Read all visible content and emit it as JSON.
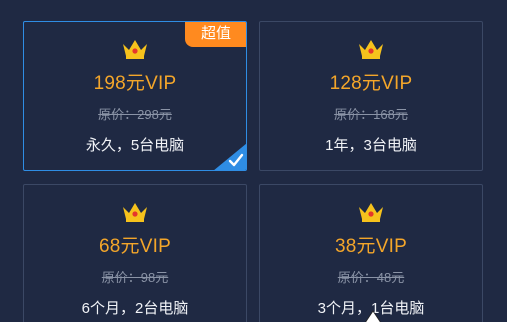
{
  "plans": [
    {
      "price_label": "198元VIP",
      "original_label": "原价：298元",
      "desc": "永久，5台电脑",
      "badge": "超值",
      "selected": true,
      "crown_icon": "crown-icon"
    },
    {
      "price_label": "128元VIP",
      "original_label": "原价：168元",
      "desc": "1年，3台电脑",
      "selected": false,
      "crown_icon": "crown-icon"
    },
    {
      "price_label": "68元VIP",
      "original_label": "原价：98元",
      "desc": "6个月，2台电脑",
      "selected": false,
      "crown_icon": "crown-icon"
    },
    {
      "price_label": "38元VIP",
      "original_label": "原价：48元",
      "desc": "3个月，1台电脑",
      "selected": false,
      "crown_icon": "crown-icon"
    }
  ],
  "colors": {
    "background": "#1f2943",
    "card_border": "#3b4865",
    "selected_border": "#2f8de4",
    "price": "#f4a62a",
    "badge": "#ff8a1f"
  }
}
